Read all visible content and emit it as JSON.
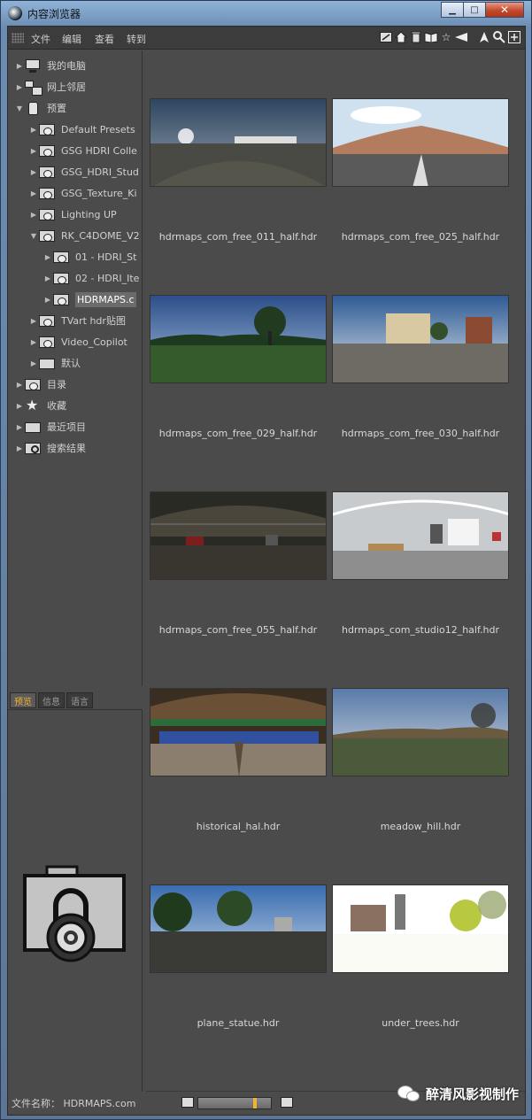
{
  "window": {
    "title": "内容浏览器",
    "minimize": "▁",
    "maximize": "□",
    "close": "✕"
  },
  "menu": [
    "文件",
    "编辑",
    "查看",
    "转到"
  ],
  "toolbar_icons": [
    "edit-icon",
    "home-icon",
    "trash-icon",
    "book-icon",
    "star-icon",
    "back-icon",
    "up-arrow-icon",
    "search-icon",
    "add-icon"
  ],
  "tree": [
    {
      "label": "我的电脑",
      "icon": "computer-icon",
      "depth": 0,
      "expanded": false
    },
    {
      "label": "网上邻居",
      "icon": "network-icon",
      "depth": 0,
      "expanded": false
    },
    {
      "label": "预置",
      "icon": "preset-icon",
      "depth": 0,
      "expanded": true
    },
    {
      "label": "Default Presets",
      "icon": "lib-folder-icon",
      "depth": 1,
      "expanded": false
    },
    {
      "label": "GSG HDRI Colle",
      "icon": "lib-folder-icon",
      "depth": 1,
      "expanded": false
    },
    {
      "label": "GSG_HDRI_Stud",
      "icon": "lib-folder-icon",
      "depth": 1,
      "expanded": false
    },
    {
      "label": "GSG_Texture_Ki",
      "icon": "lib-folder-icon",
      "depth": 1,
      "expanded": false
    },
    {
      "label": "Lighting UP",
      "icon": "lib-folder-icon",
      "depth": 1,
      "expanded": false
    },
    {
      "label": "RK_C4DOME_V2",
      "icon": "lib-folder-icon",
      "depth": 1,
      "expanded": true
    },
    {
      "label": "01 - HDRI_St",
      "icon": "lib-folder-icon",
      "depth": 2,
      "expanded": false
    },
    {
      "label": "02 - HDRI_Ite",
      "icon": "lib-folder-icon",
      "depth": 2,
      "expanded": false
    },
    {
      "label": "HDRMAPS.c",
      "icon": "lib-folder-icon",
      "depth": 2,
      "expanded": false,
      "selected": true
    },
    {
      "label": "TVart hdr贴图",
      "icon": "lib-folder-icon",
      "depth": 1,
      "expanded": false
    },
    {
      "label": "Video_Copilot",
      "icon": "lib-folder-icon",
      "depth": 1,
      "expanded": false
    },
    {
      "label": "默认",
      "icon": "plain-folder-icon",
      "depth": 1,
      "expanded": false
    },
    {
      "label": "目录",
      "icon": "catalog-icon",
      "depth": 0,
      "expanded": false
    },
    {
      "label": "收藏",
      "icon": "favorite-star-icon",
      "depth": 0,
      "expanded": false
    },
    {
      "label": "最近项目",
      "icon": "recent-folder-icon",
      "depth": 0,
      "expanded": false
    },
    {
      "label": "搜索结果",
      "icon": "search-results-icon",
      "depth": 0,
      "expanded": false
    }
  ],
  "tabs": [
    "预览",
    "信息",
    "语言"
  ],
  "status": {
    "filename": "文件名称： HDRMAPS.com"
  },
  "grid_items": [
    {
      "label": "hdrmaps_com_free_011_half.hdr"
    },
    {
      "label": "hdrmaps_com_free_025_half.hdr"
    },
    {
      "label": "hdrmaps_com_free_029_half.hdr"
    },
    {
      "label": "hdrmaps_com_free_030_half.hdr"
    },
    {
      "label": "hdrmaps_com_free_055_half.hdr"
    },
    {
      "label": "hdrmaps_com_studio12_half.hdr"
    },
    {
      "label": "historical_hal.hdr"
    },
    {
      "label": "meadow_hill.hdr"
    },
    {
      "label": "plane_statue.hdr"
    },
    {
      "label": "under_trees.hdr"
    }
  ],
  "zoom": {
    "level": 0.78
  },
  "watermark": {
    "text": "醉清风影视制作"
  },
  "colors": {
    "accent": "#f2b233",
    "panel": "#4b4b4b"
  }
}
